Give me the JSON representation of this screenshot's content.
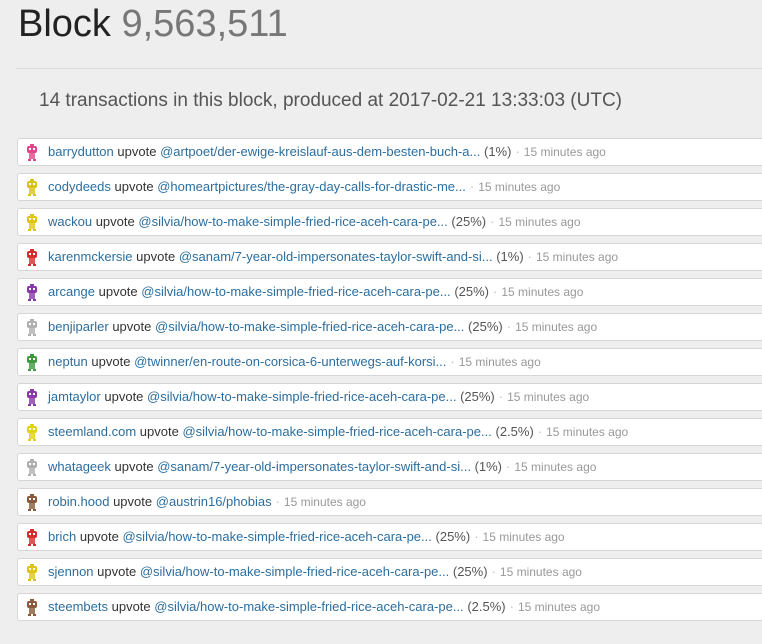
{
  "header": {
    "label": "Block",
    "number": "9,563,511"
  },
  "summary": "14 transactions in this block, produced at 2017-02-21 13:33:03 (UTC)",
  "transactions": [
    {
      "user": "barrydutton",
      "action": "upvote",
      "link": "@artpoet/der-ewige-kreislauf-aus-dem-besten-buch-a...",
      "weight": "(1%)",
      "time": "15 minutes ago",
      "color": "#e0478f"
    },
    {
      "user": "codydeeds",
      "action": "upvote",
      "link": "@homeartpictures/the-gray-day-calls-for-drastic-me...",
      "weight": "",
      "time": "15 minutes ago",
      "color": "#d9c21a"
    },
    {
      "user": "wackou",
      "action": "upvote",
      "link": "@silvia/how-to-make-simple-fried-rice-aceh-cara-pe...",
      "weight": "(25%)",
      "time": "15 minutes ago",
      "color": "#e0c414"
    },
    {
      "user": "karenmckersie",
      "action": "upvote",
      "link": "@sanam/7-year-old-impersonates-taylor-swift-and-si...",
      "weight": "(1%)",
      "time": "15 minutes ago",
      "color": "#d62c2c"
    },
    {
      "user": "arcange",
      "action": "upvote",
      "link": "@silvia/how-to-make-simple-fried-rice-aceh-cara-pe...",
      "weight": "(25%)",
      "time": "15 minutes ago",
      "color": "#8a3aa8"
    },
    {
      "user": "benjiparler",
      "action": "upvote",
      "link": "@silvia/how-to-make-simple-fried-rice-aceh-cara-pe...",
      "weight": "(25%)",
      "time": "15 minutes ago",
      "color": "#b0b0b0"
    },
    {
      "user": "neptun",
      "action": "upvote",
      "link": "@twinner/en-route-on-corsica-6-unterwegs-auf-korsi...",
      "weight": "",
      "time": "15 minutes ago",
      "color": "#3f9a3f"
    },
    {
      "user": "jamtaylor",
      "action": "upvote",
      "link": "@silvia/how-to-make-simple-fried-rice-aceh-cara-pe...",
      "weight": "(25%)",
      "time": "15 minutes ago",
      "color": "#8a3aa8"
    },
    {
      "user": "steemland.com",
      "action": "upvote",
      "link": "@silvia/how-to-make-simple-fried-rice-aceh-cara-pe...",
      "weight": "(2.5%)",
      "time": "15 minutes ago",
      "color": "#e0d214"
    },
    {
      "user": "whatageek",
      "action": "upvote",
      "link": "@sanam/7-year-old-impersonates-taylor-swift-and-si...",
      "weight": "(1%)",
      "time": "15 minutes ago",
      "color": "#b0b0b0"
    },
    {
      "user": "robin.hood",
      "action": "upvote",
      "link": "@austrin16/phobias",
      "weight": "",
      "time": "15 minutes ago",
      "color": "#8b5a3c"
    },
    {
      "user": "brich",
      "action": "upvote",
      "link": "@silvia/how-to-make-simple-fried-rice-aceh-cara-pe...",
      "weight": "(25%)",
      "time": "15 minutes ago",
      "color": "#d62c2c"
    },
    {
      "user": "sjennon",
      "action": "upvote",
      "link": "@silvia/how-to-make-simple-fried-rice-aceh-cara-pe...",
      "weight": "(25%)",
      "time": "15 minutes ago",
      "color": "#e0c414"
    },
    {
      "user": "steembets",
      "action": "upvote",
      "link": "@silvia/how-to-make-simple-fried-rice-aceh-cara-pe...",
      "weight": "(2.5%)",
      "time": "15 minutes ago",
      "color": "#8b5a3c"
    }
  ]
}
